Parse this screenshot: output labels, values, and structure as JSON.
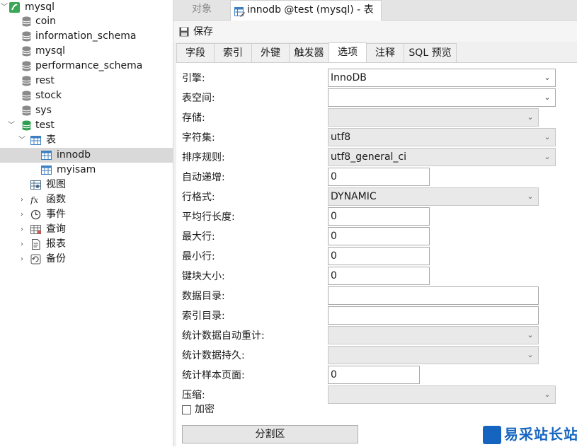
{
  "tree": {
    "items": [
      {
        "label": "mysql",
        "icon": "connection-icon"
      },
      {
        "label": "coin",
        "icon": "database-icon"
      },
      {
        "label": "information_schema",
        "icon": "database-icon"
      },
      {
        "label": "mysql",
        "icon": "database-icon"
      },
      {
        "label": "performance_schema",
        "icon": "database-icon"
      },
      {
        "label": "rest",
        "icon": "database-icon"
      },
      {
        "label": "stock",
        "icon": "database-icon"
      },
      {
        "label": "sys",
        "icon": "database-icon"
      },
      {
        "label": "test",
        "icon": "database-open-icon"
      },
      {
        "label": "表",
        "icon": "tables-folder-icon"
      },
      {
        "label": "innodb",
        "icon": "table-icon"
      },
      {
        "label": "myisam",
        "icon": "table-icon"
      },
      {
        "label": "视图",
        "icon": "views-icon"
      },
      {
        "label": "函数",
        "icon": "function-icon"
      },
      {
        "label": "事件",
        "icon": "event-clock-icon"
      },
      {
        "label": "查询",
        "icon": "query-icon"
      },
      {
        "label": "报表",
        "icon": "report-icon"
      },
      {
        "label": "备份",
        "icon": "backup-icon"
      }
    ]
  },
  "tabs": {
    "objects": "对象",
    "table": "innodb @test (mysql) - 表"
  },
  "toolbar": {
    "save": "保存"
  },
  "subtabs": [
    "字段",
    "索引",
    "外键",
    "触发器",
    "选项",
    "注释",
    "SQL 预览"
  ],
  "active_subtab": "选项",
  "form": {
    "engine": {
      "label": "引擎:",
      "value": "InnoDB"
    },
    "tablespace": {
      "label": "表空间:",
      "value": ""
    },
    "storage": {
      "label": "存储:",
      "value": ""
    },
    "charset": {
      "label": "字符集:",
      "value": "utf8"
    },
    "collation": {
      "label": "排序规则:",
      "value": "utf8_general_ci"
    },
    "auto_increment": {
      "label": "自动递增:",
      "value": "0"
    },
    "row_format": {
      "label": "行格式:",
      "value": "DYNAMIC"
    },
    "avg_row_length": {
      "label": "平均行长度:",
      "value": "0"
    },
    "max_rows": {
      "label": "最大行:",
      "value": "0"
    },
    "min_rows": {
      "label": "最小行:",
      "value": "0"
    },
    "key_block_size": {
      "label": "键块大小:",
      "value": "0"
    },
    "data_directory": {
      "label": "数据目录:",
      "value": ""
    },
    "index_directory": {
      "label": "索引目录:",
      "value": ""
    },
    "stats_auto_recalc": {
      "label": "统计数据自动重计:",
      "value": ""
    },
    "stats_persistent": {
      "label": "统计数据持久:",
      "value": ""
    },
    "stats_sample_pages": {
      "label": "统计样本页面:",
      "value": "0"
    },
    "compression": {
      "label": "压缩:",
      "value": ""
    },
    "encryption": {
      "label": "加密",
      "checked": false
    },
    "partition_button": "分割区"
  },
  "watermark": {
    "text": "易采站长站"
  },
  "colors": {
    "selection": "#d9d9d9",
    "db_icon": "#808080",
    "db_open_icon": "#2e9e4f",
    "accent": "#1565c0"
  }
}
